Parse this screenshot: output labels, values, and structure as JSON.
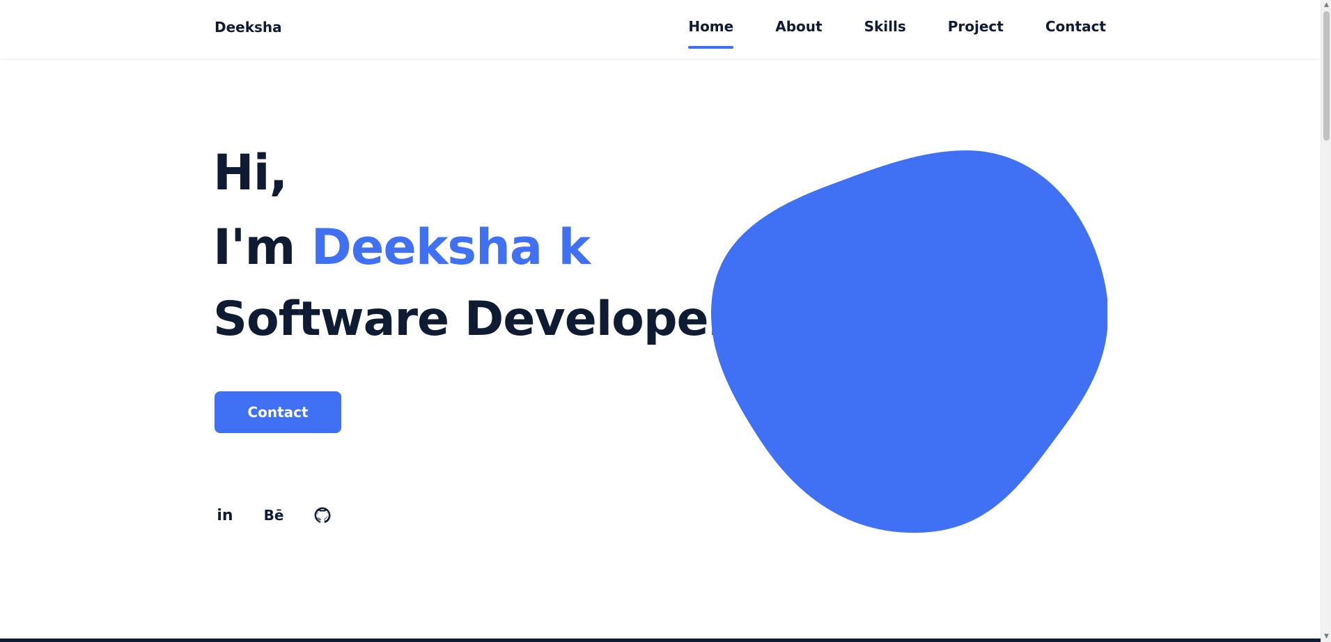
{
  "header": {
    "brand": "Deeksha",
    "nav": [
      {
        "label": "Home",
        "active": true
      },
      {
        "label": "About",
        "active": false
      },
      {
        "label": "Skills",
        "active": false
      },
      {
        "label": "Project",
        "active": false
      },
      {
        "label": "Contact",
        "active": false
      }
    ]
  },
  "hero": {
    "line1": "Hi,",
    "line2_prefix": "I'm ",
    "line2_name": "Deeksha k",
    "line3": "Software Developer",
    "cta_label": "Contact"
  },
  "socials": [
    {
      "icon": "linkedin-icon",
      "text": "in"
    },
    {
      "icon": "behance-icon",
      "text": "Bē"
    },
    {
      "icon": "github-icon",
      "text": ""
    }
  ],
  "colors": {
    "accent": "#4070f4",
    "dark": "#0f1a33",
    "background": "#ffffff"
  }
}
